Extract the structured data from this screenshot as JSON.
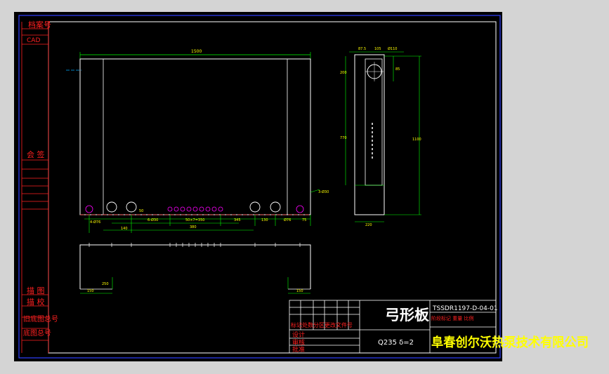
{
  "side_labels": {
    "doc_no": "档案号",
    "cad": "CAD",
    "sign": "会 签",
    "draw": "描 图",
    "check": "描 校",
    "old_base": "旧底图总号",
    "base_total": "底图总号"
  },
  "front_view": {
    "overall_width": "1500",
    "hole_note_left": "4-Ø76",
    "hole_note_mid": "6-Ø30",
    "hole_note_right": "3-Ø30",
    "pitch_label": "50×7=350",
    "dims": [
      "140",
      "380",
      "345",
      "130",
      "Ø76",
      "75",
      "50"
    ]
  },
  "side_view": {
    "top_dims": [
      "87.5",
      "105",
      "Ø110"
    ],
    "left_top": "200",
    "left_main": "770",
    "right_main": "1100",
    "right_small": "85",
    "bottom": "220"
  },
  "bottom_view": {
    "left_dim": "150",
    "right_dim": "150",
    "height_dim": "250"
  },
  "title_block": {
    "part_name": "弓形板",
    "drawing_no": "TSSDR1197-D-04-01",
    "material": "Q235 δ=2",
    "company": "阜春创尔沃热泵技术有限公司",
    "row_label_1": "标记处数分区更改文件号",
    "row_label_2": "设计",
    "row_label_3": "审核",
    "row_label_4": "批准",
    "stage_label": "阶段标记 重量 比例"
  }
}
